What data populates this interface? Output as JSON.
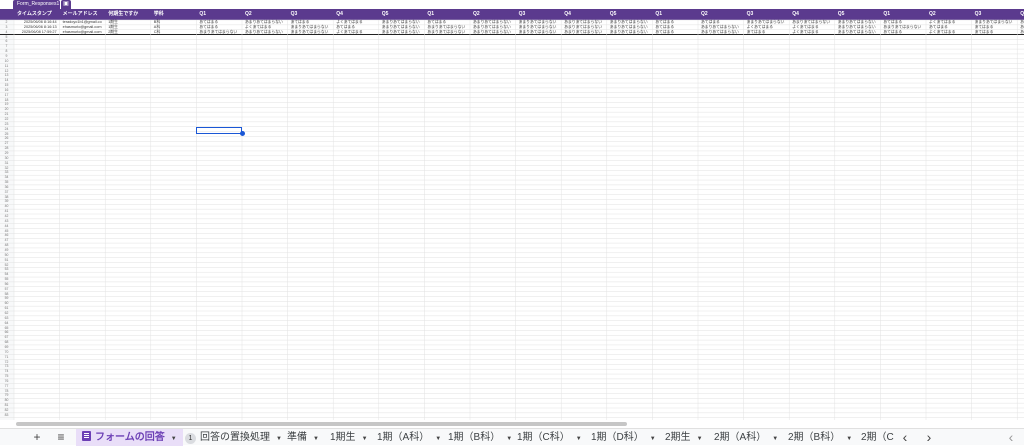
{
  "table": {
    "name_tab": "Form_Responses1",
    "options_icon": "table-icon"
  },
  "columns": [
    "タイムスタンプ",
    "メールアドレス",
    "何期生ですか",
    "学科",
    "Q1",
    "Q2",
    "Q3",
    "Q4",
    "Q5",
    "Q1",
    "Q2",
    "Q3",
    "Q4",
    "Q5",
    "Q1",
    "Q2",
    "Q3",
    "Q4",
    "Q5",
    "Q1",
    "Q2",
    "Q3",
    "Q4"
  ],
  "rows": [
    [
      "2025/06/06 8:16:44",
      "teradoyo1b1@gmail.co",
      "1期生",
      "B科",
      "あてはまる",
      "あまりあてはまらない",
      "あてはまる",
      "よくあてはまる",
      "あまりあてはまらない",
      "あてはまる",
      "あまりあてはまらない",
      "あまりあてはまらない",
      "あまりあてはまらない",
      "あまりあてはまらない",
      "あてはまる",
      "あてはまる",
      "あまりあてはまらない",
      "あまりあてはまらない",
      "あまりあてはまらない",
      "あてはまる",
      "よくあてはまる",
      "あまりあてはまらない",
      "あまりあてはまらない"
    ],
    [
      "2025/06/06 8:16:13",
      "ehasmurlo@gmail.com",
      "1期生",
      "A科",
      "あてはまる",
      "よくあてはまる",
      "あまりあてはまらない",
      "あてはまる",
      "あまりあてはまらない",
      "あまりあてはまらない",
      "あまりあてはまらない",
      "あまりあてはまらない",
      "あまりあてはまらない",
      "あまりあてはまらない",
      "あてはまる",
      "あまりあてはまらない",
      "よくあてはまる",
      "よくあてはまる",
      "あまりあてはまらない",
      "あまりあてはまらない",
      "あてはまる",
      "あてはまる",
      "あまりあてはまらない"
    ],
    [
      "2025/06/08 17:59:27",
      "ehasmurlo@gmail.com",
      "2期生",
      "C科",
      "あまりあてはまらない",
      "あまりあてはまらない",
      "あまりあてはまらない",
      "よくあてはまる",
      "あまりあてはまらない",
      "あまりあてはまらない",
      "あまりあてはまらない",
      "あまりあてはまらない",
      "あまりあてはまらない",
      "あまりあてはまらない",
      "あてはまる",
      "あまりあてはまらない",
      "あてはまる",
      "よくあてはまる",
      "あまりあてはまらない",
      "あてはまる",
      "よくあてはまる",
      "あてはまる",
      "あまりあてはまらない"
    ]
  ],
  "bottom": {
    "add_sheet_icon": "plus-icon",
    "all_sheets_icon": "menu-icon",
    "active_tab": "フォームの回答",
    "badge": "1",
    "tabs": [
      "回答の置換処理",
      "準備",
      "1期生",
      "1期（A科）",
      "1期（B科）",
      "1期（C科）",
      "1期（D科）",
      "2期生",
      "2期（A科）",
      "2期（B科）",
      "2期（C"
    ],
    "scroll_left": "‹",
    "scroll_right": "›"
  },
  "colors": {
    "header_bg": "#5b3a8e",
    "accent": "#6c3fb5",
    "selection": "#1a57d6"
  }
}
